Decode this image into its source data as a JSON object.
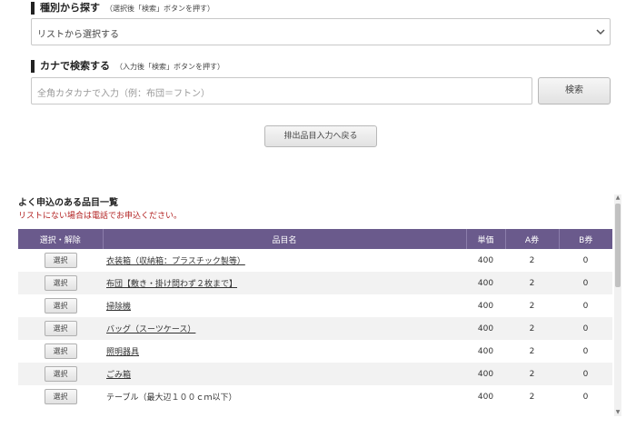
{
  "category_search": {
    "title": "種別から探す",
    "hint": "（選択後「検索」ボタンを押す）",
    "select_value": "リストから選択する"
  },
  "kana_search": {
    "title": "カナで検索する",
    "hint": "（入力後「検索」ボタンを押す）",
    "placeholder": "全角カタカナで入力（例：布団＝フトン）",
    "search_label": "検索"
  },
  "back_button_label": "排出品目入力へ戻る",
  "frequent_items": {
    "title": "よく申込のある品目一覧",
    "note": "リストにない場合は電話でお申込ください。",
    "headers": [
      "選択・解除",
      "品目名",
      "単価",
      "A券",
      "B券"
    ],
    "select_label": "選択",
    "rows": [
      {
        "name": "衣装箱（収納箱：プラスチック製等）",
        "price": "400",
        "a": "2",
        "b": "0",
        "link": true
      },
      {
        "name": "布団【敷き・掛け問わず２枚まで】",
        "price": "400",
        "a": "2",
        "b": "0",
        "link": true
      },
      {
        "name": "掃除機",
        "price": "400",
        "a": "2",
        "b": "0",
        "link": true
      },
      {
        "name": "バッグ（スーツケース）",
        "price": "400",
        "a": "2",
        "b": "0",
        "link": true
      },
      {
        "name": "照明器具",
        "price": "400",
        "a": "2",
        "b": "0",
        "link": true
      },
      {
        "name": "ごみ箱",
        "price": "400",
        "a": "2",
        "b": "0",
        "link": true
      },
      {
        "name": "テーブル（最大辺１００ｃｍ以下）",
        "price": "400",
        "a": "2",
        "b": "0",
        "link": false
      }
    ]
  }
}
